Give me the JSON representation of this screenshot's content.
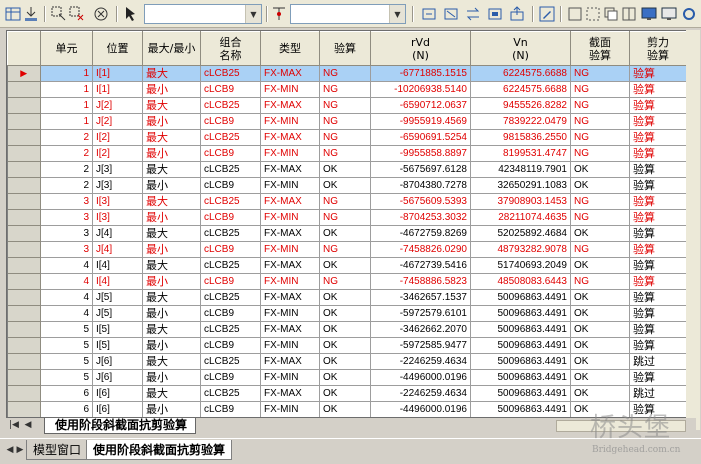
{
  "toolbar": {
    "combo1_value": "",
    "combo2_value": ""
  },
  "table": {
    "headers": [
      "",
      "单元",
      "位置",
      "最大/最小",
      "组合\n名称",
      "类型",
      "验算",
      "rVd\n(N)",
      "Vn\n(N)",
      "截面\n验算",
      "剪力\n验算"
    ],
    "rows": [
      {
        "indicator": "▶",
        "elem": "1",
        "pos": "I[1]",
        "maxmin": "最大",
        "combo": "cLCB25",
        "type": "FX-MAX",
        "check": "NG",
        "rvd": "-6771885.1515",
        "vn": "6224575.6688",
        "sect": "NG",
        "shear": "验算",
        "red": true,
        "current": true
      },
      {
        "indicator": "",
        "elem": "1",
        "pos": "I[1]",
        "maxmin": "最小",
        "combo": "cLCB9",
        "type": "FX-MIN",
        "check": "NG",
        "rvd": "-10206938.5140",
        "vn": "6224575.6688",
        "sect": "NG",
        "shear": "验算",
        "red": true
      },
      {
        "indicator": "",
        "elem": "1",
        "pos": "J[2]",
        "maxmin": "最大",
        "combo": "cLCB25",
        "type": "FX-MAX",
        "check": "NG",
        "rvd": "-6590712.0637",
        "vn": "9455526.8282",
        "sect": "NG",
        "shear": "验算",
        "red": true
      },
      {
        "indicator": "",
        "elem": "1",
        "pos": "J[2]",
        "maxmin": "最小",
        "combo": "cLCB9",
        "type": "FX-MIN",
        "check": "NG",
        "rvd": "-9955919.4569",
        "vn": "7839222.0479",
        "sect": "NG",
        "shear": "验算",
        "red": true
      },
      {
        "indicator": "",
        "elem": "2",
        "pos": "I[2]",
        "maxmin": "最大",
        "combo": "cLCB25",
        "type": "FX-MAX",
        "check": "NG",
        "rvd": "-6590691.5254",
        "vn": "9815836.2550",
        "sect": "NG",
        "shear": "验算",
        "red": true
      },
      {
        "indicator": "",
        "elem": "2",
        "pos": "I[2]",
        "maxmin": "最小",
        "combo": "cLCB9",
        "type": "FX-MIN",
        "check": "NG",
        "rvd": "-9955858.8897",
        "vn": "8199531.4747",
        "sect": "NG",
        "shear": "验算",
        "red": true
      },
      {
        "indicator": "",
        "elem": "2",
        "pos": "J[3]",
        "maxmin": "最大",
        "combo": "cLCB25",
        "type": "FX-MAX",
        "check": "OK",
        "rvd": "-5675697.6128",
        "vn": "42348119.7901",
        "sect": "OK",
        "shear": "验算",
        "red": false
      },
      {
        "indicator": "",
        "elem": "2",
        "pos": "J[3]",
        "maxmin": "最小",
        "combo": "cLCB9",
        "type": "FX-MIN",
        "check": "OK",
        "rvd": "-8704380.7278",
        "vn": "32650291.1083",
        "sect": "OK",
        "shear": "验算",
        "red": false
      },
      {
        "indicator": "",
        "elem": "3",
        "pos": "I[3]",
        "maxmin": "最大",
        "combo": "cLCB25",
        "type": "FX-MAX",
        "check": "NG",
        "rvd": "-5675609.5393",
        "vn": "37908903.1453",
        "sect": "NG",
        "shear": "验算",
        "red": true
      },
      {
        "indicator": "",
        "elem": "3",
        "pos": "I[3]",
        "maxmin": "最小",
        "combo": "cLCB9",
        "type": "FX-MIN",
        "check": "NG",
        "rvd": "-8704253.3032",
        "vn": "28211074.4635",
        "sect": "NG",
        "shear": "验算",
        "red": true
      },
      {
        "indicator": "",
        "elem": "3",
        "pos": "J[4]",
        "maxmin": "最大",
        "combo": "cLCB25",
        "type": "FX-MAX",
        "check": "OK",
        "rvd": "-4672759.8269",
        "vn": "52025892.4684",
        "sect": "OK",
        "shear": "验算",
        "red": false
      },
      {
        "indicator": "",
        "elem": "3",
        "pos": "J[4]",
        "maxmin": "最小",
        "combo": "cLCB9",
        "type": "FX-MIN",
        "check": "NG",
        "rvd": "-7458826.0290",
        "vn": "48793282.9078",
        "sect": "NG",
        "shear": "验算",
        "red": true
      },
      {
        "indicator": "",
        "elem": "4",
        "pos": "I[4]",
        "maxmin": "最大",
        "combo": "cLCB25",
        "type": "FX-MAX",
        "check": "OK",
        "rvd": "-4672739.5416",
        "vn": "51740693.2049",
        "sect": "OK",
        "shear": "验算",
        "red": false
      },
      {
        "indicator": "",
        "elem": "4",
        "pos": "I[4]",
        "maxmin": "最小",
        "combo": "cLCB9",
        "type": "FX-MIN",
        "check": "NG",
        "rvd": "-7458886.5823",
        "vn": "48508083.6443",
        "sect": "NG",
        "shear": "验算",
        "red": true
      },
      {
        "indicator": "",
        "elem": "4",
        "pos": "J[5]",
        "maxmin": "最大",
        "combo": "cLCB25",
        "type": "FX-MAX",
        "check": "OK",
        "rvd": "-3462657.1537",
        "vn": "50096863.4491",
        "sect": "OK",
        "shear": "验算",
        "red": false
      },
      {
        "indicator": "",
        "elem": "4",
        "pos": "J[5]",
        "maxmin": "最小",
        "combo": "cLCB9",
        "type": "FX-MIN",
        "check": "OK",
        "rvd": "-5972579.6101",
        "vn": "50096863.4491",
        "sect": "OK",
        "shear": "验算",
        "red": false
      },
      {
        "indicator": "",
        "elem": "5",
        "pos": "I[5]",
        "maxmin": "最大",
        "combo": "cLCB25",
        "type": "FX-MAX",
        "check": "OK",
        "rvd": "-3462662.2070",
        "vn": "50096863.4491",
        "sect": "OK",
        "shear": "验算",
        "red": false
      },
      {
        "indicator": "",
        "elem": "5",
        "pos": "I[5]",
        "maxmin": "最小",
        "combo": "cLCB9",
        "type": "FX-MIN",
        "check": "OK",
        "rvd": "-5972585.9477",
        "vn": "50096863.4491",
        "sect": "OK",
        "shear": "验算",
        "red": false
      },
      {
        "indicator": "",
        "elem": "5",
        "pos": "J[6]",
        "maxmin": "最大",
        "combo": "cLCB25",
        "type": "FX-MAX",
        "check": "OK",
        "rvd": "-2246259.4634",
        "vn": "50096863.4491",
        "sect": "OK",
        "shear": "跳过",
        "red": false
      },
      {
        "indicator": "",
        "elem": "5",
        "pos": "J[6]",
        "maxmin": "最小",
        "combo": "cLCB9",
        "type": "FX-MIN",
        "check": "OK",
        "rvd": "-4496000.0196",
        "vn": "50096863.4491",
        "sect": "OK",
        "shear": "验算",
        "red": false
      },
      {
        "indicator": "",
        "elem": "6",
        "pos": "I[6]",
        "maxmin": "最大",
        "combo": "cLCB25",
        "type": "FX-MAX",
        "check": "OK",
        "rvd": "-2246259.4634",
        "vn": "50096863.4491",
        "sect": "OK",
        "shear": "跳过",
        "red": false
      },
      {
        "indicator": "",
        "elem": "6",
        "pos": "I[6]",
        "maxmin": "最小",
        "combo": "cLCB9",
        "type": "FX-MIN",
        "check": "OK",
        "rvd": "-4496000.0196",
        "vn": "50096863.4491",
        "sect": "OK",
        "shear": "验算",
        "red": false
      }
    ]
  },
  "sheet_tab": {
    "label": "使用阶段斜截面抗剪验算"
  },
  "bottom_tabs": [
    {
      "label": "模型窗口"
    },
    {
      "label": "使用阶段斜截面抗剪验算"
    }
  ],
  "watermark": {
    "big": "桥头堡",
    "small": "Bridgehead.com.cn"
  },
  "colors": {
    "ng_text": "#e00000",
    "current_row_bg": "#aad1f5",
    "header_bg": "#ece9d8"
  }
}
